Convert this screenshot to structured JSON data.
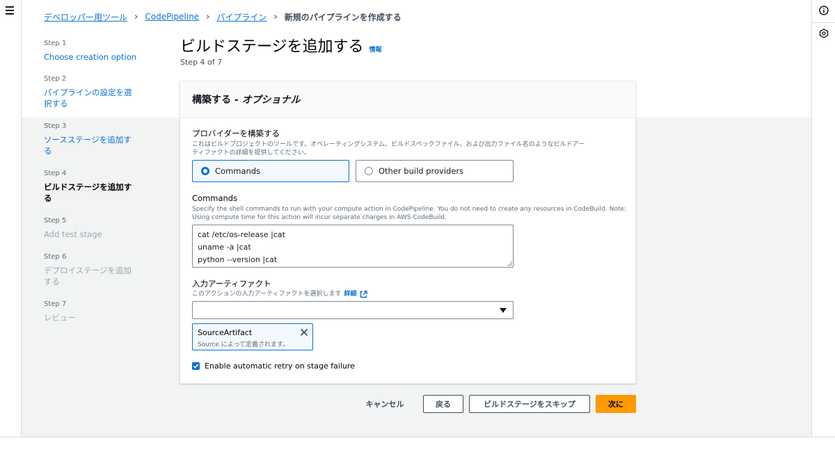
{
  "breadcrumb": {
    "items": [
      "デベロッパー用ツール",
      "CodePipeline",
      "パイプライン"
    ],
    "current": "新規のパイプラインを作成する"
  },
  "steps": [
    {
      "num": "Step 1",
      "title": "Choose creation option",
      "state": "link"
    },
    {
      "num": "Step 2",
      "title": "パイプラインの設定を選択する",
      "state": "link"
    },
    {
      "num": "Step 3",
      "title": "ソースステージを追加する",
      "state": "link"
    },
    {
      "num": "Step 4",
      "title": "ビルドステージを追加する",
      "state": "current"
    },
    {
      "num": "Step 5",
      "title": "Add test stage",
      "state": "disabled"
    },
    {
      "num": "Step 6",
      "title": "デプロイステージを追加する",
      "state": "disabled"
    },
    {
      "num": "Step 7",
      "title": "レビュー",
      "state": "disabled"
    }
  ],
  "page": {
    "title": "ビルドステージを追加する",
    "info": "情報",
    "step_count": "Step 4 of 7"
  },
  "panel": {
    "header_main": "構築する - ",
    "header_optional": "オプショナル",
    "provider": {
      "label": "プロバイダーを構築する",
      "desc_line1": "これはビルドプロジェクトのツールです。オペレーティングシステム、ビルドスペックファイル、および出力ファイル名のようなビルドアー",
      "desc_line2": "ティファクトの詳細を提供してください。",
      "option_commands": "Commands",
      "option_other": "Other build providers",
      "selected": "Commands"
    },
    "commands": {
      "label": "Commands",
      "desc_line1": "Specify the shell commands to run with your compute action in CodePipeline. You do not need to create any resources in CodeBuild. Note:",
      "desc_line2": "Using compute time for this action will incur separate charges in AWS CodeBuild.",
      "lines": [
        "cat /etc/os-release |cat",
        "uname -a |cat",
        "python --version |cat"
      ]
    },
    "input_artifacts": {
      "label": "入力アーティファクト",
      "desc": "このアクションの入力アーティファクトを選択します",
      "detail_link": "詳細",
      "select_value": "",
      "token_name": "SourceArtifact",
      "token_desc": "Source によって定義されます。"
    },
    "retry": {
      "label": "Enable automatic retry on stage failure",
      "checked": true
    }
  },
  "buttons": {
    "cancel": "キャンセル",
    "back": "戻る",
    "skip": "ビルドステージをスキップ",
    "next": "次に"
  },
  "colors": {
    "link": "#0972d3",
    "primary": "#ff9900",
    "background": "#f2f3f3"
  }
}
